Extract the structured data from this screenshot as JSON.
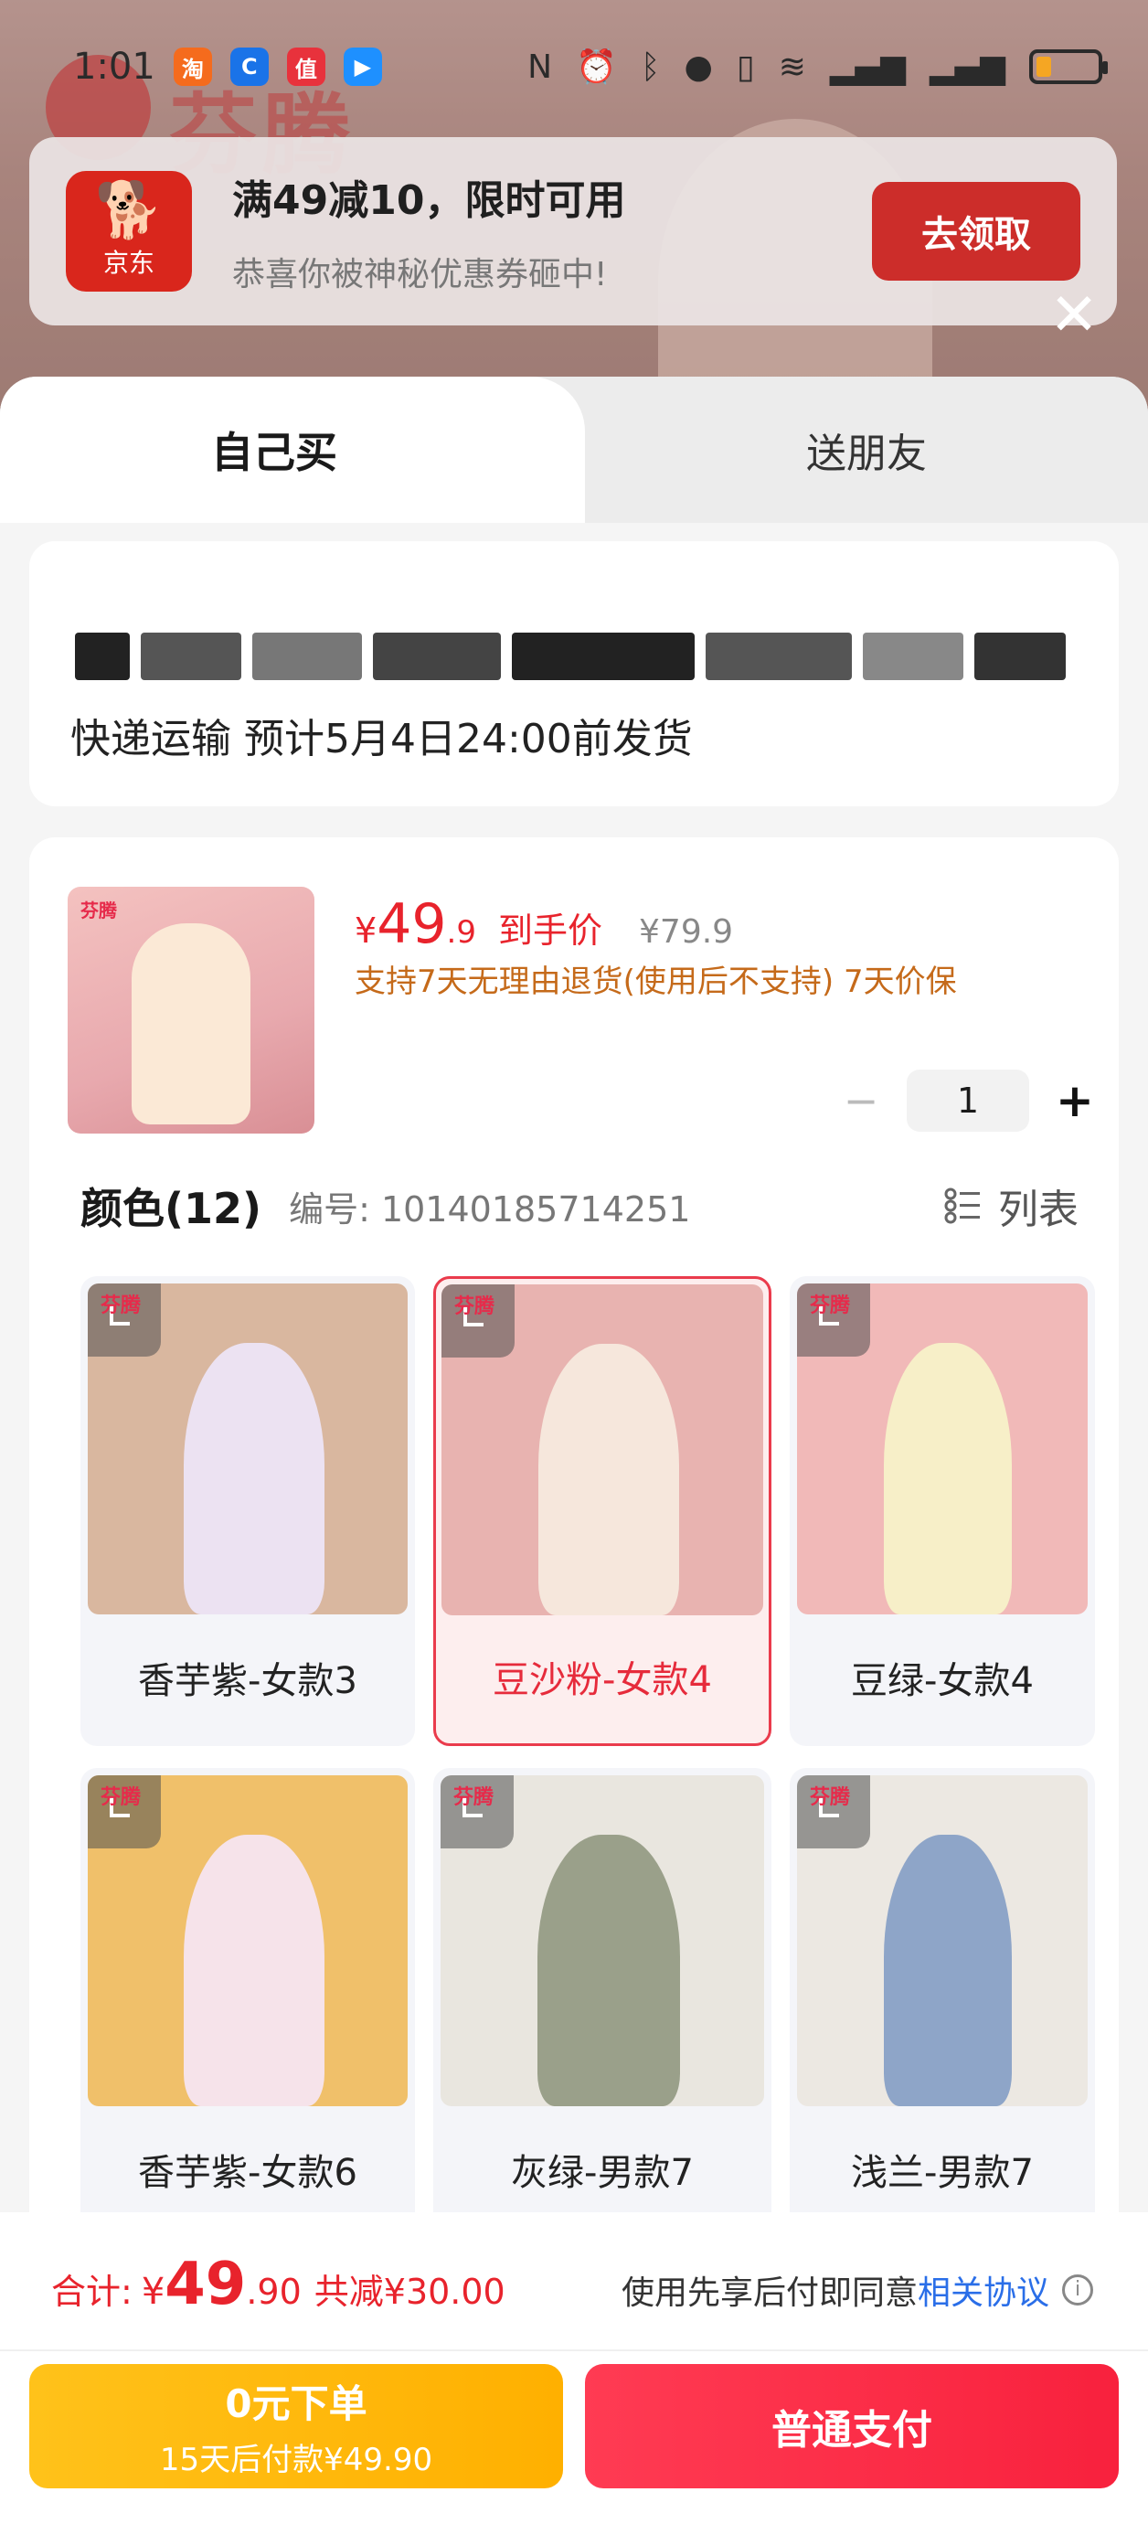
{
  "status_bar": {
    "time": "1:01",
    "app_icons": [
      "taobao-icon",
      "chrome-icon",
      "zhidemai-icon",
      "maps-icon"
    ],
    "right_icons": [
      "nfc-icon",
      "alarm-icon",
      "bluetooth-icon",
      "location-icon",
      "vibrate-icon",
      "wifi-icon",
      "signal-icon",
      "signal-icon",
      "battery-icon"
    ]
  },
  "background": {
    "brand": "芬腾"
  },
  "coupon": {
    "logo_text": "京东",
    "title": "满49减10，限时可用",
    "subtitle": "恭喜你被神秘优惠券砸中!",
    "button": "去领取"
  },
  "tabs": {
    "self": "自己买",
    "friend": "送朋友"
  },
  "shipping": {
    "text": "快递运输 预计5月4日24:00前发货"
  },
  "product": {
    "thumb_brand": "芬腾",
    "price_currency": "¥",
    "price_int": "49",
    "price_dec": ".9",
    "price_tag": "到手价",
    "original_price": "¥79.9",
    "policy": "支持7天无理由退货(使用后不支持) 7天价保",
    "qty_minus": "−",
    "quantity": "1",
    "qty_plus": "+"
  },
  "colors": {
    "title": "颜色(12)",
    "code_label": "编号: 10140185714251",
    "list_label": "列表",
    "items": [
      {
        "label": "香芋紫-女款3",
        "brand": "芬腾",
        "bg": "#d9b79f",
        "fig": "#ece2f2"
      },
      {
        "label": "豆沙粉-女款4",
        "brand": "芬腾",
        "bg": "#e8b3b0",
        "fig": "#f6e7dc"
      },
      {
        "label": "豆绿-女款4",
        "brand": "芬腾",
        "bg": "#f1b9b8",
        "fig": "#f7efc8"
      },
      {
        "label": "香芋紫-女款6",
        "brand": "芬腾",
        "bg": "#f0c06a",
        "fig": "#f6e3ea"
      },
      {
        "label": "灰绿-男款7",
        "brand": "芬腾",
        "bg": "#e9e6df",
        "fig": "#9aa08a"
      },
      {
        "label": "浅兰-男款7",
        "brand": "芬腾",
        "bg": "#ece8e2",
        "fig": "#8ea5c8"
      }
    ],
    "selected_index": 1
  },
  "footer": {
    "total_label": "合计:",
    "total_currency": "¥",
    "total_int": "49",
    "total_dec": ".90",
    "total_save": "共减¥30.00",
    "agree_text": "使用先享后付即同意",
    "agree_link": "相关协议",
    "bnpl_line1": "0元下单",
    "bnpl_line2": "15天后付款¥49.90",
    "pay_button": "普通支付"
  },
  "accent_colors": {
    "red": "#e8232c",
    "orange": "#ffb000",
    "link": "#2a6ee8"
  }
}
